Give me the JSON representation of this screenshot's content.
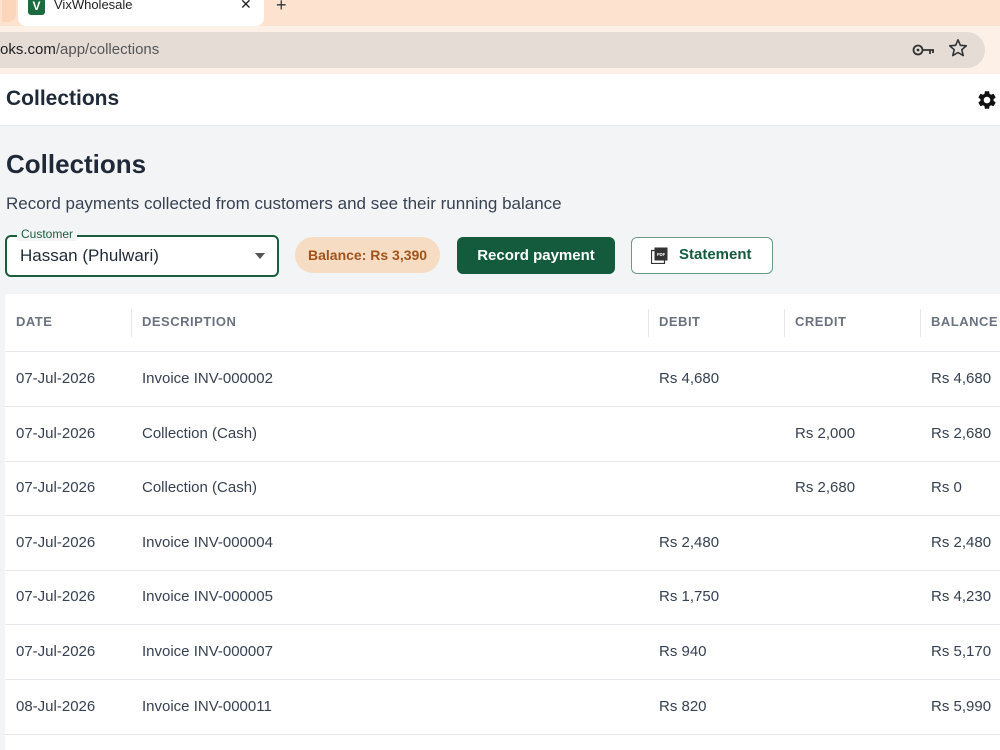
{
  "browser": {
    "tab_title": "VixWholesale",
    "tab_favicon": "V",
    "url_host": "oks.com",
    "url_path": "/app/collections",
    "icons": [
      "key-icon",
      "star-icon",
      "close-icon",
      "plus-icon"
    ]
  },
  "app": {
    "header_title": "Collections",
    "settings_icon": "gear-icon"
  },
  "page": {
    "title": "Collections",
    "subtitle": "Record payments collected from customers and see their running balance"
  },
  "controls": {
    "customer_label": "Customer",
    "customer_value": "Hassan (Phulwari)",
    "balance": "Balance: Rs 3,390",
    "record_button": "Record payment",
    "statement_button": "Statement",
    "statement_icon": "pdf-icon"
  },
  "colors": {
    "primary": "#135b3c",
    "balance_chip_bg": "#f7dcc4",
    "balance_chip_text": "#a0531a"
  },
  "table": {
    "headers": [
      "DATE",
      "DESCRIPTION",
      "DEBIT",
      "CREDIT",
      "BALANCE"
    ],
    "rows": [
      {
        "date": "07-Jul-2026",
        "description": "Invoice INV-000002",
        "debit": "Rs 4,680",
        "credit": "",
        "balance": "Rs 4,680"
      },
      {
        "date": "07-Jul-2026",
        "description": "Collection (Cash)",
        "debit": "",
        "credit": "Rs 2,000",
        "balance": "Rs 2,680"
      },
      {
        "date": "07-Jul-2026",
        "description": "Collection (Cash)",
        "debit": "",
        "credit": "Rs 2,680",
        "balance": "Rs 0"
      },
      {
        "date": "07-Jul-2026",
        "description": "Invoice INV-000004",
        "debit": "Rs 2,480",
        "credit": "",
        "balance": "Rs 2,480"
      },
      {
        "date": "07-Jul-2026",
        "description": "Invoice INV-000005",
        "debit": "Rs 1,750",
        "credit": "",
        "balance": "Rs 4,230"
      },
      {
        "date": "07-Jul-2026",
        "description": "Invoice INV-000007",
        "debit": "Rs 940",
        "credit": "",
        "balance": "Rs 5,170"
      },
      {
        "date": "08-Jul-2026",
        "description": "Invoice INV-000011",
        "debit": "Rs 820",
        "credit": "",
        "balance": "Rs 5,990"
      }
    ]
  }
}
